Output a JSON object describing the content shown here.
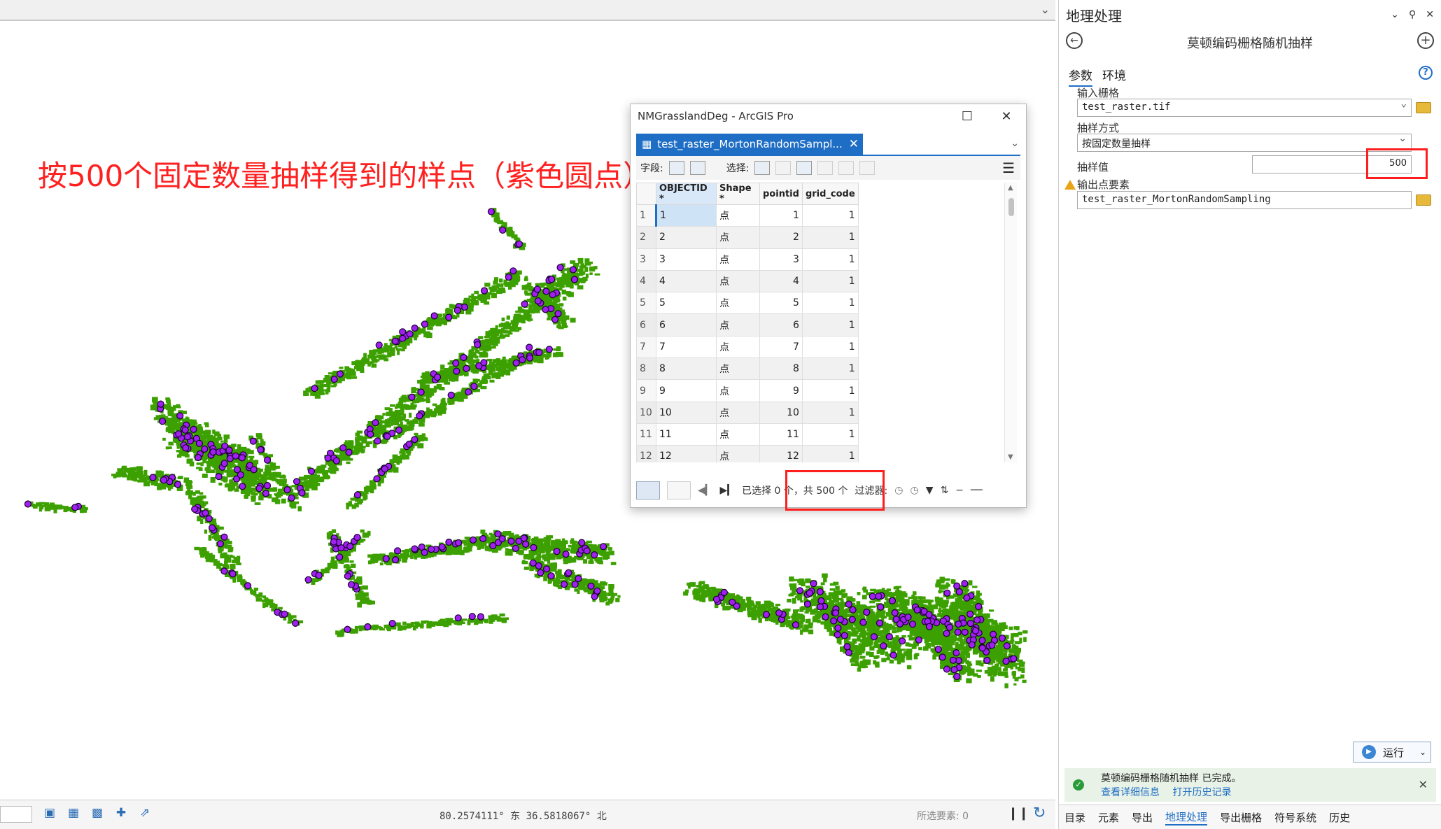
{
  "map": {
    "caption": "按500个固定数量抽样得到的样点（紫色圆点）",
    "colors": {
      "raster": "#3ca000",
      "points": "#a020f0",
      "point_outline": "#1a0033",
      "caption": "#ff2020"
    },
    "status": {
      "scale": "",
      "coordinates": "80.2574111° 东  36.5818067° 北",
      "selected_features": "所选要素: 0"
    }
  },
  "table_window": {
    "title": "NMGrasslandDeg - ArcGIS Pro",
    "tab_label": "test_raster_MortonRandomSampl...",
    "toolbar": {
      "fields_label": "字段:",
      "select_label": "选择:"
    },
    "columns": [
      "OBJECTID *",
      "Shape *",
      "pointid",
      "grid_code"
    ],
    "rows": [
      {
        "n": "1",
        "objectid": "1",
        "shape": "点",
        "pointid": "1",
        "grid_code": "1"
      },
      {
        "n": "2",
        "objectid": "2",
        "shape": "点",
        "pointid": "2",
        "grid_code": "1"
      },
      {
        "n": "3",
        "objectid": "3",
        "shape": "点",
        "pointid": "3",
        "grid_code": "1"
      },
      {
        "n": "4",
        "objectid": "4",
        "shape": "点",
        "pointid": "4",
        "grid_code": "1"
      },
      {
        "n": "5",
        "objectid": "5",
        "shape": "点",
        "pointid": "5",
        "grid_code": "1"
      },
      {
        "n": "6",
        "objectid": "6",
        "shape": "点",
        "pointid": "6",
        "grid_code": "1"
      },
      {
        "n": "7",
        "objectid": "7",
        "shape": "点",
        "pointid": "7",
        "grid_code": "1"
      },
      {
        "n": "8",
        "objectid": "8",
        "shape": "点",
        "pointid": "8",
        "grid_code": "1"
      },
      {
        "n": "9",
        "objectid": "9",
        "shape": "点",
        "pointid": "9",
        "grid_code": "1"
      },
      {
        "n": "10",
        "objectid": "10",
        "shape": "点",
        "pointid": "10",
        "grid_code": "1"
      },
      {
        "n": "11",
        "objectid": "11",
        "shape": "点",
        "pointid": "11",
        "grid_code": "1"
      },
      {
        "n": "12",
        "objectid": "12",
        "shape": "点",
        "pointid": "12",
        "grid_code": "1"
      }
    ],
    "footer": {
      "selection_text": "已选择 0 个，共 500 个",
      "filter_label": "过滤器:"
    }
  },
  "gp_pane": {
    "title": "地理处理",
    "tool_title": "莫顿编码栅格随机抽样",
    "tabs": {
      "params": "参数",
      "env": "环境"
    },
    "params": {
      "input_raster_label": "输入栅格",
      "input_raster_value": "test_raster.tif",
      "method_label": "抽样方式",
      "method_value": "按固定数量抽样",
      "sample_value_label": "抽样值",
      "sample_value": "500",
      "output_label": "输出点要素",
      "output_value": "test_raster_MortonRandomSampling"
    },
    "run_label": "运行",
    "status": {
      "message": "莫顿编码栅格随机抽样  已完成。",
      "link_details": "查看详细信息",
      "link_history": "打开历史记录"
    },
    "bottom_tabs": [
      "目录",
      "元素",
      "导出",
      "地理处理",
      "导出栅格",
      "符号系统",
      "历史"
    ],
    "active_bottom_tab": "地理处理"
  }
}
